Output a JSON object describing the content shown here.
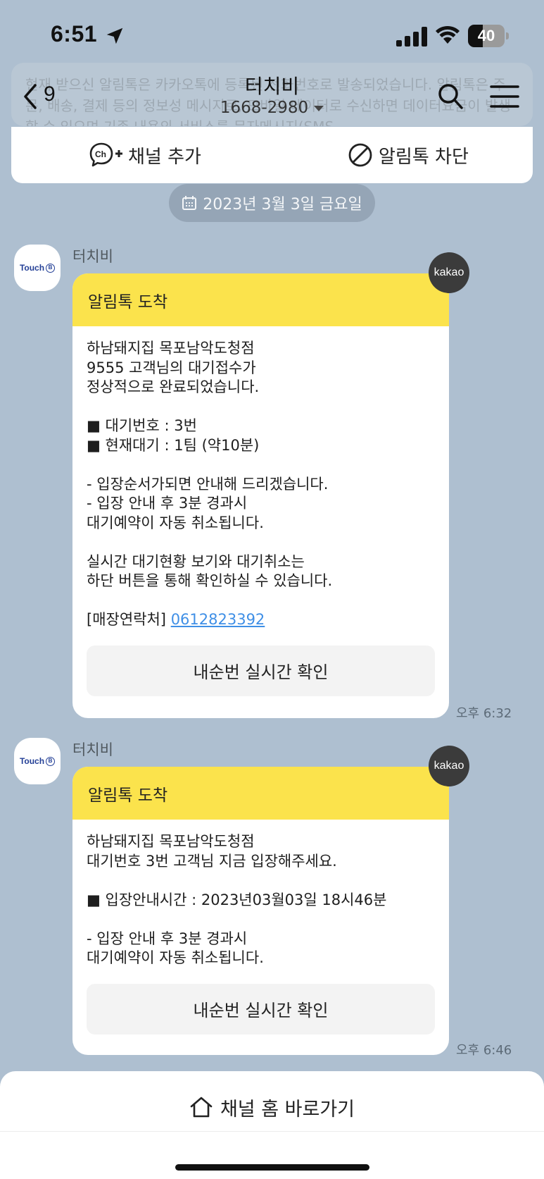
{
  "status_bar": {
    "time": "6:51",
    "battery_text": "40",
    "battery_level": 0.4
  },
  "header": {
    "back_count": "9",
    "title": "터치비",
    "subtitle": "1668-2980",
    "notice_text": "현재 받으신 알림톡은 카카오톡에 등록된 전화번호로 발송되었습니다. 알림톡은 주문, 배송, 결제 등의 정보성 메시지로, 모바일 데이터로 수신하면 데이터요금이 발생할 수 있으며 기존 내용의 서비스를 문자메시지(SMS"
  },
  "actions": {
    "add_channel": "채널 추가",
    "block": "알림톡 차단"
  },
  "date_divider": "2023년 3월 3일 금요일",
  "messages": [
    {
      "sender": "터치비",
      "avatar_text": "Touch",
      "badge": "kakao",
      "header": "알림톡 도착",
      "lines": [
        "하남돼지집 목포남악도청점",
        "9555 고객님의 대기접수가",
        "정상적으로 완료되었습니다.",
        "",
        "■ 대기번호 : 3번",
        "■ 현재대기 : 1팀 (약10분)",
        "",
        "- 입장순서가되면 안내해 드리겠습니다.",
        "- 입장 안내 후 3분 경과시",
        "대기예약이 자동 취소됩니다.",
        "",
        "실시간 대기현황 보기와 대기취소는",
        "하단 버튼을 통해 확인하실 수 있습니다.",
        ""
      ],
      "contact_label": "[매장연락처]",
      "contact_phone": "0612823392",
      "button": "내순번 실시간 확인",
      "time": "오후 6:32"
    },
    {
      "sender": "터치비",
      "avatar_text": "Touch",
      "badge": "kakao",
      "header": "알림톡 도착",
      "lines": [
        "하남돼지집 목포남악도청점",
        "대기번호 3번 고객님 지금 입장해주세요.",
        "",
        "■ 입장안내시간 : 2023년03월03일 18시46분",
        "",
        "- 입장 안내 후 3분 경과시",
        "대기예약이 자동 취소됩니다."
      ],
      "button": "내순번 실시간 확인",
      "time": "오후 6:46"
    }
  ],
  "bottom": {
    "home_link": "채널 홈 바로가기"
  }
}
